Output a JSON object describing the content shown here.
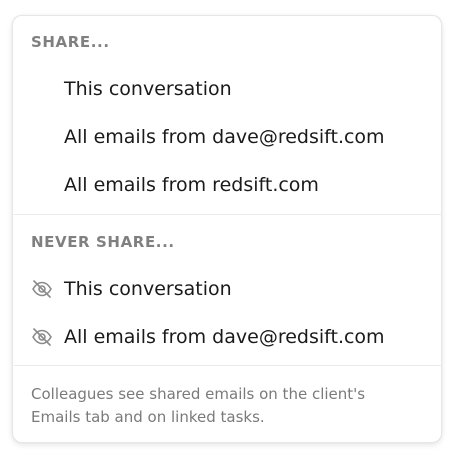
{
  "menu": {
    "share_header": "SHARE...",
    "share_items": [
      {
        "label": "This conversation"
      },
      {
        "label": "All emails from dave@redsift.com"
      },
      {
        "label": "All emails from redsift.com"
      }
    ],
    "never_share_header": "NEVER SHARE...",
    "never_share_items": [
      {
        "label": "This conversation",
        "icon": "eye-off-icon"
      },
      {
        "label": "All emails from dave@redsift.com",
        "icon": "eye-off-icon"
      }
    ],
    "footer_text": "Colleagues see shared emails on the client's Emails tab and on linked tasks."
  },
  "colors": {
    "header_text": "#808080",
    "item_text": "#1a1a1a",
    "footer_text": "#7a7a7a",
    "divider": "#ececec"
  }
}
